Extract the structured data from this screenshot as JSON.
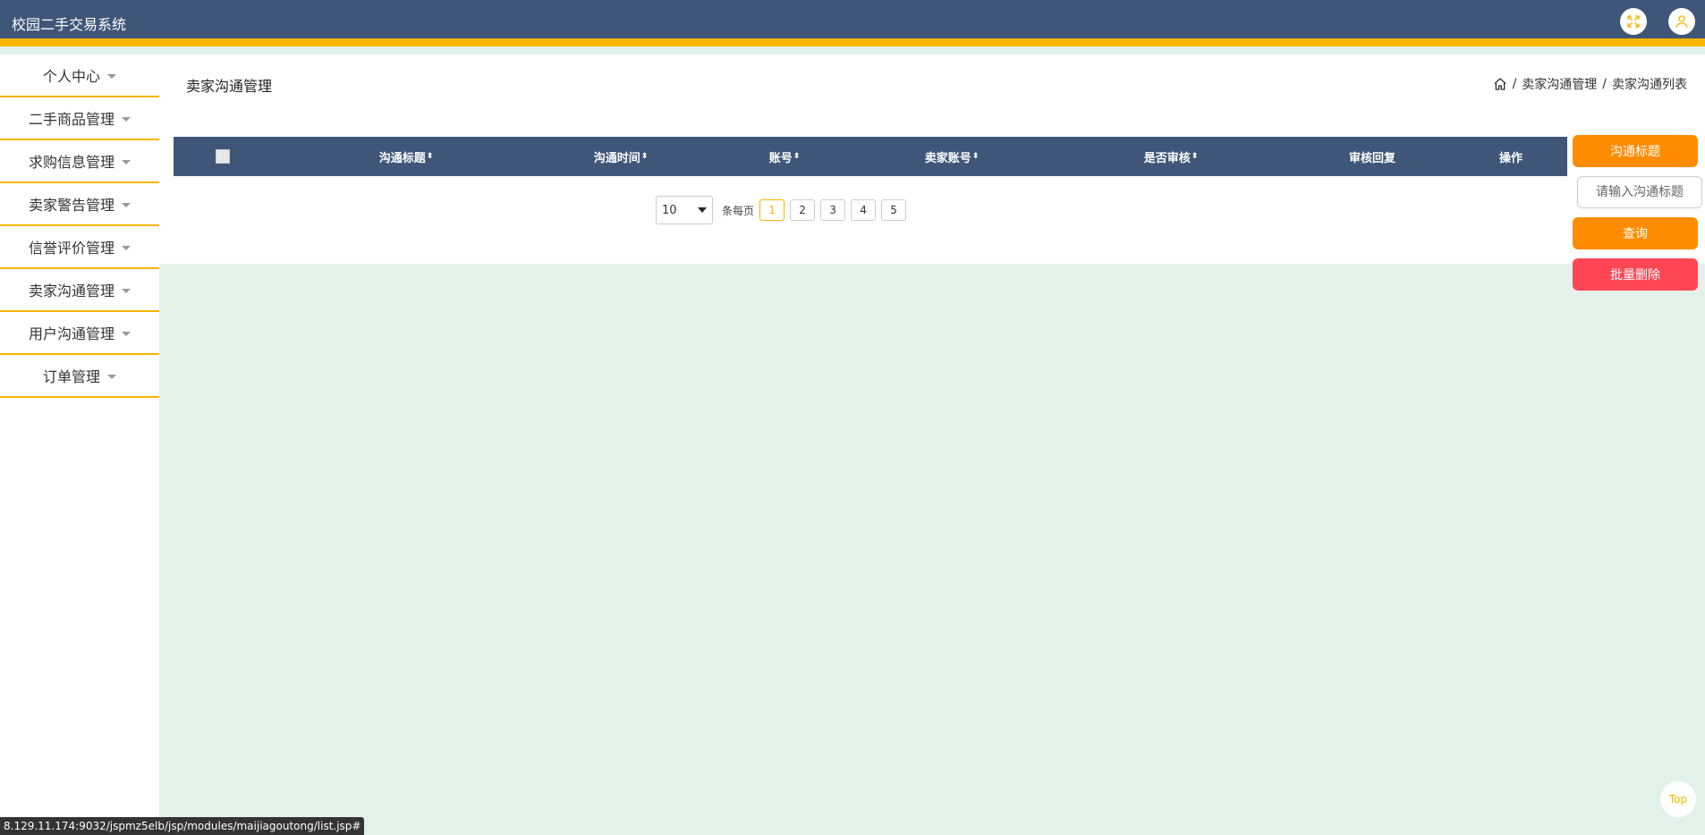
{
  "app": {
    "title": "校园二手交易系统"
  },
  "header": {
    "fullscreen_icon": "expand-arrows-icon",
    "user_icon": "user-icon"
  },
  "sidebar": {
    "items": [
      {
        "label": "个人中心"
      },
      {
        "label": "二手商品管理"
      },
      {
        "label": "求购信息管理"
      },
      {
        "label": "卖家警告管理"
      },
      {
        "label": "信誉评价管理"
      },
      {
        "label": "卖家沟通管理"
      },
      {
        "label": "用户沟通管理"
      },
      {
        "label": "订单管理"
      }
    ]
  },
  "page": {
    "title": "卖家沟通管理",
    "breadcrumb": {
      "level1": "卖家沟通管理",
      "level2": "卖家沟通列表",
      "separator": "/"
    }
  },
  "table": {
    "columns": [
      "沟通标题",
      "沟通时间",
      "账号",
      "卖家账号",
      "是否审核",
      "审核回复",
      "操作"
    ],
    "sort_glyph": "⬍"
  },
  "pagination": {
    "page_size": "10",
    "per_page_label": "条每页",
    "pages": [
      "1",
      "2",
      "3",
      "4",
      "5"
    ],
    "current_page": "1"
  },
  "search": {
    "field_label": "沟通标题",
    "placeholder": "请输入沟通标题",
    "query_button": "查询",
    "batch_delete_button": "批量删除"
  },
  "back_to_top": "Top",
  "status_bar": {
    "url": "8.129.11.174:9032/jspmz5elb/jsp/modules/maijiagoutong/list.jsp#"
  },
  "colors": {
    "header": "#3f5679",
    "accent": "#f7b500",
    "orange": "#ff8c00",
    "red": "#ff4655",
    "content_bg": "#e4f1eb"
  }
}
